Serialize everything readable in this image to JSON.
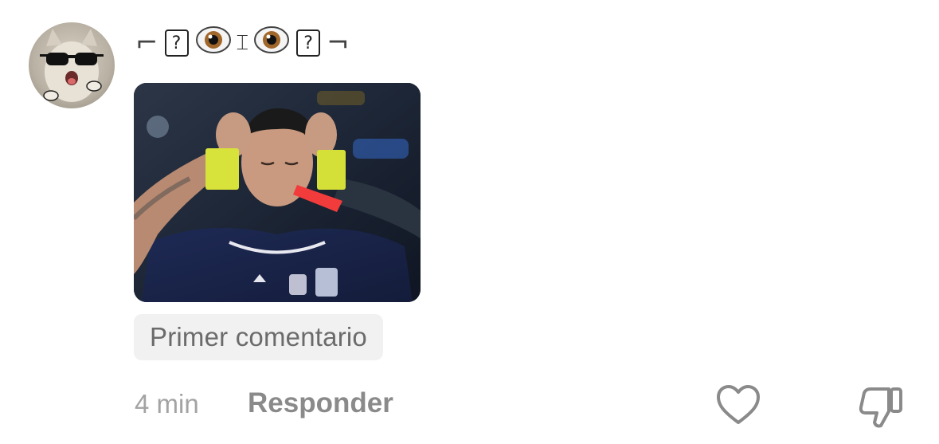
{
  "comment": {
    "username": {
      "left_corner": "⌐",
      "box1": "?",
      "eye_icon": "eye-emoji",
      "mouth": "⌶",
      "box2": "?",
      "right_corner": "¬"
    },
    "avatar_icon": "cat-with-sunglasses-avatar",
    "media_description_icon": "player-with-yellow-and-red-cards-image",
    "badge": "Primer comentario",
    "time": "4 min",
    "reply_label": "Responder",
    "like_icon": "heart-icon",
    "dislike_icon": "thumbs-down-icon"
  },
  "colors": {
    "text_primary": "#333333",
    "text_muted": "#a3a3a3",
    "reply": "#8a8a8a",
    "badge_bg": "#f1f1f2",
    "badge_text": "#6b6b6b",
    "yellow_card": "#d7e23a",
    "red_card": "#f23b3b"
  }
}
